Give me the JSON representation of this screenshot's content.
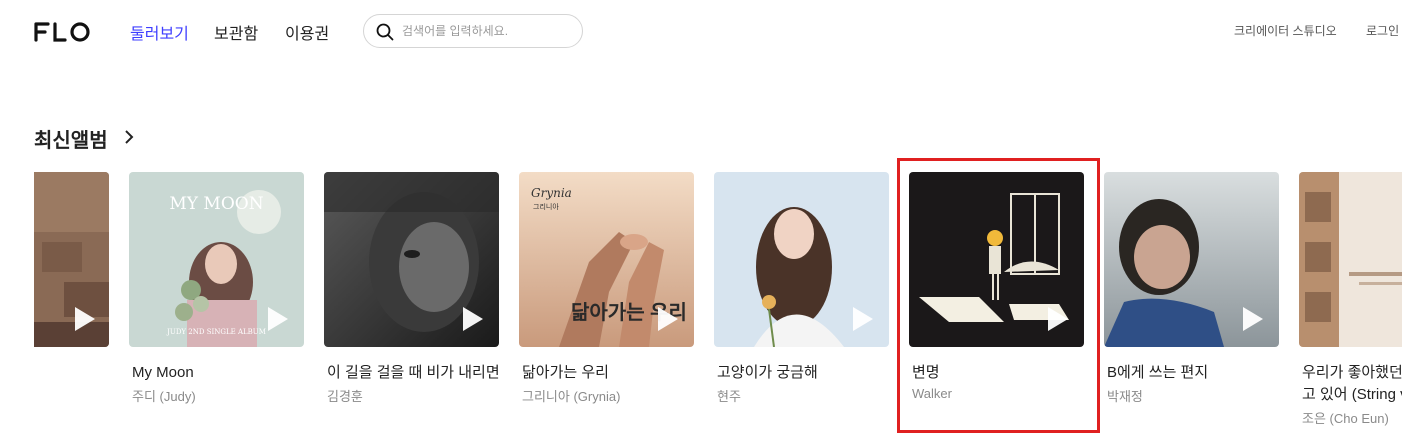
{
  "header": {
    "logo_text": "FLO",
    "nav": [
      {
        "label": "둘러보기",
        "active": true
      },
      {
        "label": "보관함",
        "active": false
      },
      {
        "label": "이용권",
        "active": false
      }
    ],
    "search": {
      "placeholder": "검색어를 입력하세요.",
      "value": ""
    },
    "creator_studio": "크리에이터 스튜디오",
    "login": "로그인"
  },
  "section": {
    "title": "최신앨범",
    "albums": [
      {
        "title": "My Moon",
        "artist": "주디 (Judy)",
        "cover_text": "MY MOON",
        "cover_subtext": "JUDY 2ND SINGLE ALBUM"
      },
      {
        "title": "이 길을 걸을 때 비가 내리면",
        "artist": "김경훈"
      },
      {
        "title": "닮아가는 우리",
        "artist": "그리니아 (Grynia)",
        "cover_text": "닮아가는 우리",
        "cover_brand": "Grynia",
        "cover_brand_kr": "그리니아"
      },
      {
        "title": "고양이가 궁금해",
        "artist": "현주"
      },
      {
        "title": "변명",
        "artist": "Walker"
      },
      {
        "title": "B에게 쓰는 편지",
        "artist": "박재정"
      },
      {
        "title": "우리가 좋아했던",
        "title_line2": "고 있어 (String v",
        "artist": "조은 (Cho Eun)"
      }
    ]
  },
  "colors": {
    "accent": "#3f3fff",
    "highlight": "#e02020"
  }
}
